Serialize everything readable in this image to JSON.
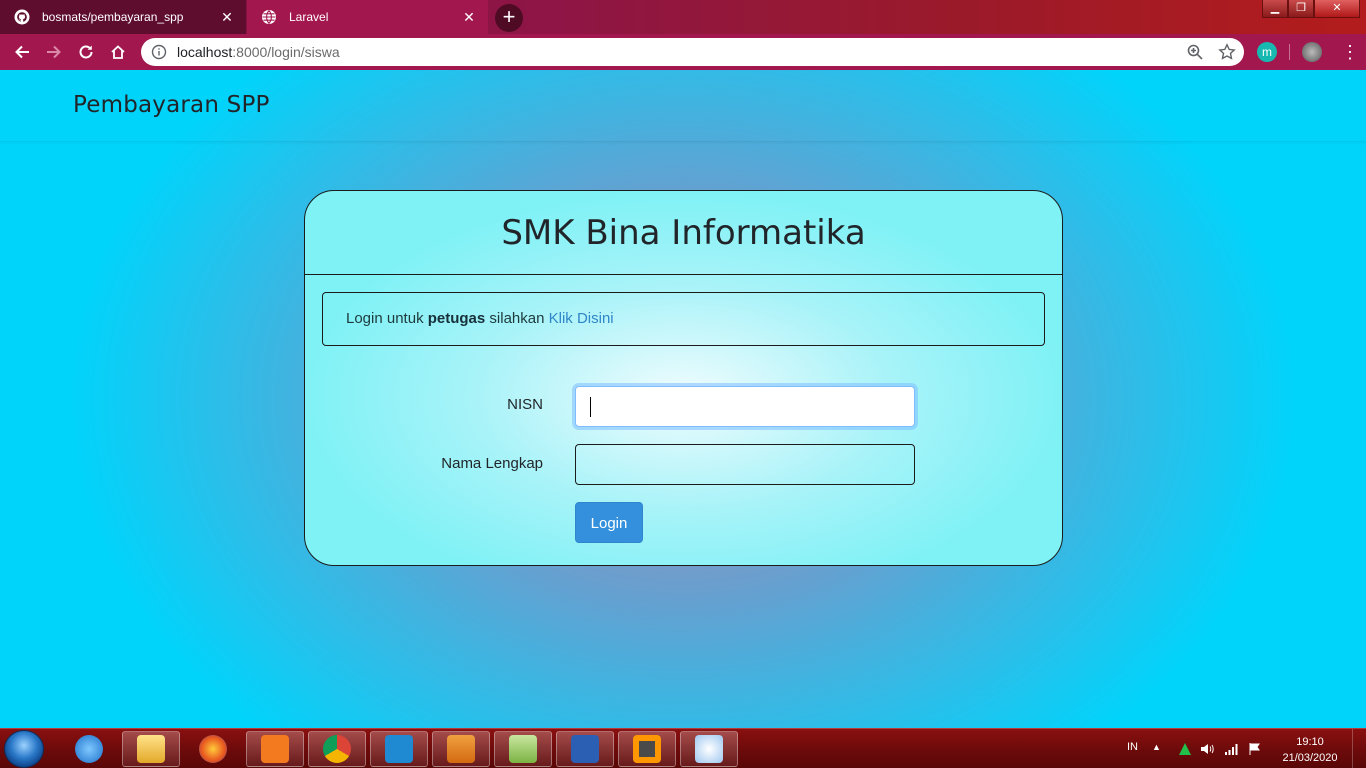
{
  "browser": {
    "tabs": [
      {
        "title": "bosmats/pembayaran_spp",
        "favicon": "github-icon",
        "active": false
      },
      {
        "title": "Laravel",
        "favicon": "globe-icon",
        "active": true
      }
    ],
    "url_host": "localhost",
    "url_path": ":8000/login/siswa",
    "profile_extension_letter": "m"
  },
  "page": {
    "brand": "Pembayaran SPP",
    "card_title": "SMK Bina Informatika",
    "alert": {
      "prefix": "Login untuk ",
      "bold": "petugas",
      "middle": " silahkan ",
      "link": "Klik Disini"
    },
    "form": {
      "nisn_label": "NISN",
      "nisn_value": "",
      "nama_label": "Nama Lengkap",
      "nama_value": "",
      "login_button": "Login"
    }
  },
  "taskbar": {
    "apps": [
      "internet-explorer-icon",
      "file-explorer-icon",
      "firefox-icon",
      "xampp-icon",
      "chrome-icon",
      "vscode-icon",
      "media-player-icon",
      "notepad-plus-plus-icon",
      "word-icon",
      "sublime-text-icon",
      "paint-icon"
    ],
    "language": "IN",
    "time": "19:10",
    "date": "21/03/2020"
  },
  "colors": {
    "accent_button": "#3490dc",
    "link": "#2f86c8",
    "page_bg": "#00d4fb",
    "chrome_frame": "#a3174f"
  }
}
